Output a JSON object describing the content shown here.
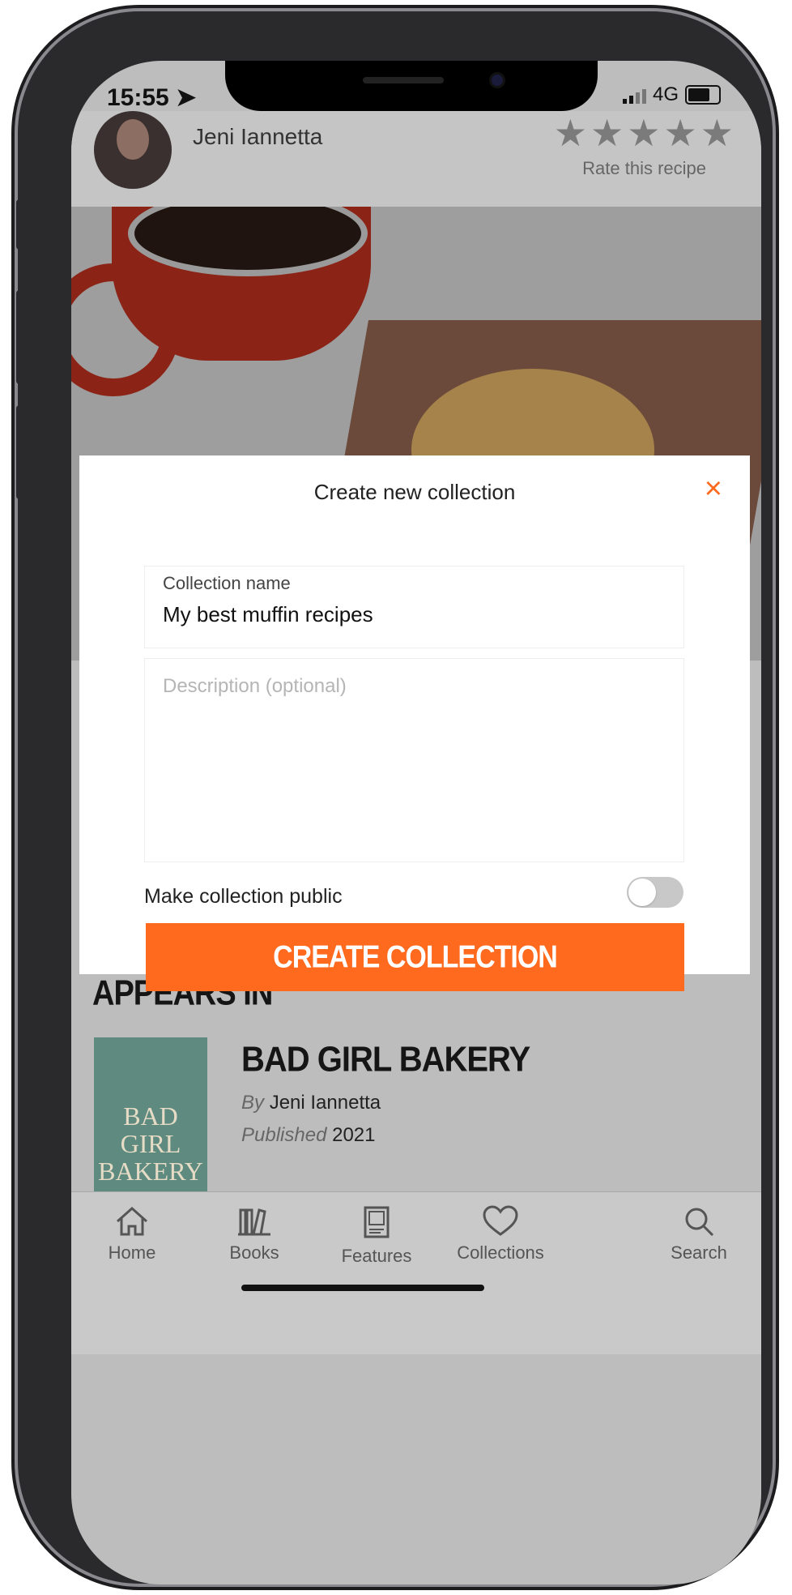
{
  "status_bar": {
    "time": "15:55",
    "network": "4G"
  },
  "recipe": {
    "author": "Jeni Iannetta",
    "rate_label": "Rate this recipe",
    "stars": "★★★★★"
  },
  "modal": {
    "title": "Create new collection",
    "close_icon": "×",
    "name_label": "Collection name",
    "name_value": "My best muffin recipes",
    "description_placeholder": "Description (optional)",
    "public_label": "Make collection public",
    "public_on": false,
    "submit_label": "CREATE COLLECTION",
    "accent": "#ff6a1f"
  },
  "appears_in": {
    "heading": "APPEARS IN",
    "book": {
      "title": "BAD GIRL BAKERY",
      "by_label": "By",
      "author": "Jeni Iannetta",
      "published_label": "Published",
      "year": "2021",
      "cover_text": "BAD GIRL BAKERY"
    }
  },
  "tabbar": {
    "items": [
      {
        "label": "Home",
        "icon": "home-icon"
      },
      {
        "label": "Books",
        "icon": "books-icon"
      },
      {
        "label": "Features",
        "icon": "features-icon"
      },
      {
        "label": "Collections",
        "icon": "heart-icon"
      },
      {
        "label": "Search",
        "icon": "search-icon"
      }
    ]
  }
}
